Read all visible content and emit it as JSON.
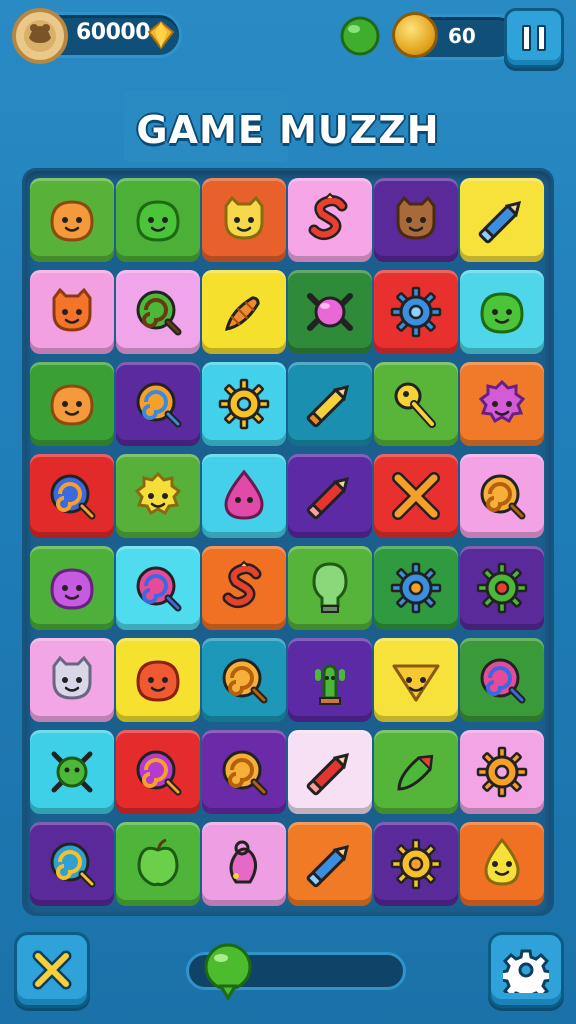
{
  "header": {
    "coins": "60000",
    "lives": "60"
  },
  "title": "GAME MUZZH",
  "progress": {
    "value": 0.08
  },
  "board": {
    "rows": 8,
    "cols": 6,
    "tiles": [
      {
        "bg": "#58b23a",
        "icon": "orange-blob"
      },
      {
        "bg": "#4cb038",
        "icon": "green-blob"
      },
      {
        "bg": "#e8612a",
        "icon": "yellow-cat"
      },
      {
        "bg": "#f6a6e6",
        "icon": "red-s-snake"
      },
      {
        "bg": "#5a2a9a",
        "icon": "brown-bear"
      },
      {
        "bg": "#f6e23a",
        "icon": "blue-pencil"
      },
      {
        "bg": "#f2a0e2",
        "icon": "orange-bear"
      },
      {
        "bg": "#f0a4ea",
        "icon": "green-target"
      },
      {
        "bg": "#f6e02e",
        "icon": "orange-carrot"
      },
      {
        "bg": "#2f8a3a",
        "icon": "pink-orb-crab"
      },
      {
        "bg": "#e8302e",
        "icon": "blue-gear-face"
      },
      {
        "bg": "#4fd6ea",
        "icon": "green-smiley"
      },
      {
        "bg": "#3aa036",
        "icon": "orange-blob"
      },
      {
        "bg": "#5a2a9e",
        "icon": "rainbow-swirl"
      },
      {
        "bg": "#42d0ea",
        "icon": "yellow-gear"
      },
      {
        "bg": "#1a8fb0",
        "icon": "yellow-pencil"
      },
      {
        "bg": "#58b53a",
        "icon": "yellow-key"
      },
      {
        "bg": "#f07a2a",
        "icon": "purple-ghost"
      },
      {
        "bg": "#e32a2a",
        "icon": "blue-lollipop"
      },
      {
        "bg": "#56b03a",
        "icon": "yellow-flower-face"
      },
      {
        "bg": "#44d0ea",
        "icon": "pink-drop"
      },
      {
        "bg": "#5d2aa6",
        "icon": "red-pencil"
      },
      {
        "bg": "#e8302e",
        "icon": "orange-cross"
      },
      {
        "bg": "#f4a2e6",
        "icon": "orange-swirl"
      },
      {
        "bg": "#4cb03a",
        "icon": "purple-blob"
      },
      {
        "bg": "#4fdcee",
        "icon": "pink-swirl"
      },
      {
        "bg": "#f07024",
        "icon": "red-s-snake"
      },
      {
        "bg": "#56b43a",
        "icon": "green-bulb"
      },
      {
        "bg": "#2f9a40",
        "icon": "blue-gear-pin"
      },
      {
        "bg": "#5a2a9a",
        "icon": "green-gear-pin"
      },
      {
        "bg": "#f2a6e6",
        "icon": "gray-cat"
      },
      {
        "bg": "#f6e22e",
        "icon": "red-blob"
      },
      {
        "bg": "#1d98b8",
        "icon": "orange-swirl"
      },
      {
        "bg": "#5d2aa6",
        "icon": "green-cactus"
      },
      {
        "bg": "#f6e23a",
        "icon": "yellow-star-face"
      },
      {
        "bg": "#3a9a3a",
        "icon": "pink-swirl"
      },
      {
        "bg": "#3ed0e6",
        "icon": "green-bug"
      },
      {
        "bg": "#e52b2b",
        "icon": "purple-swirl"
      },
      {
        "bg": "#6b2aa8",
        "icon": "orange-swirl"
      },
      {
        "bg": "#f7dff4",
        "icon": "red-pencil"
      },
      {
        "bg": "#54b53a",
        "icon": "green-rocket"
      },
      {
        "bg": "#f2a4e4",
        "icon": "orange-gear"
      },
      {
        "bg": "#5a2a9a",
        "icon": "green-lollipop"
      },
      {
        "bg": "#4fb53a",
        "icon": "green-apple"
      },
      {
        "bg": "#ee9ee2",
        "icon": "pink-shell"
      },
      {
        "bg": "#f07a26",
        "icon": "blue-pencil"
      },
      {
        "bg": "#5a2a9a",
        "icon": "yellow-sun"
      },
      {
        "bg": "#f07024",
        "icon": "yellow-drop-face"
      }
    ]
  }
}
